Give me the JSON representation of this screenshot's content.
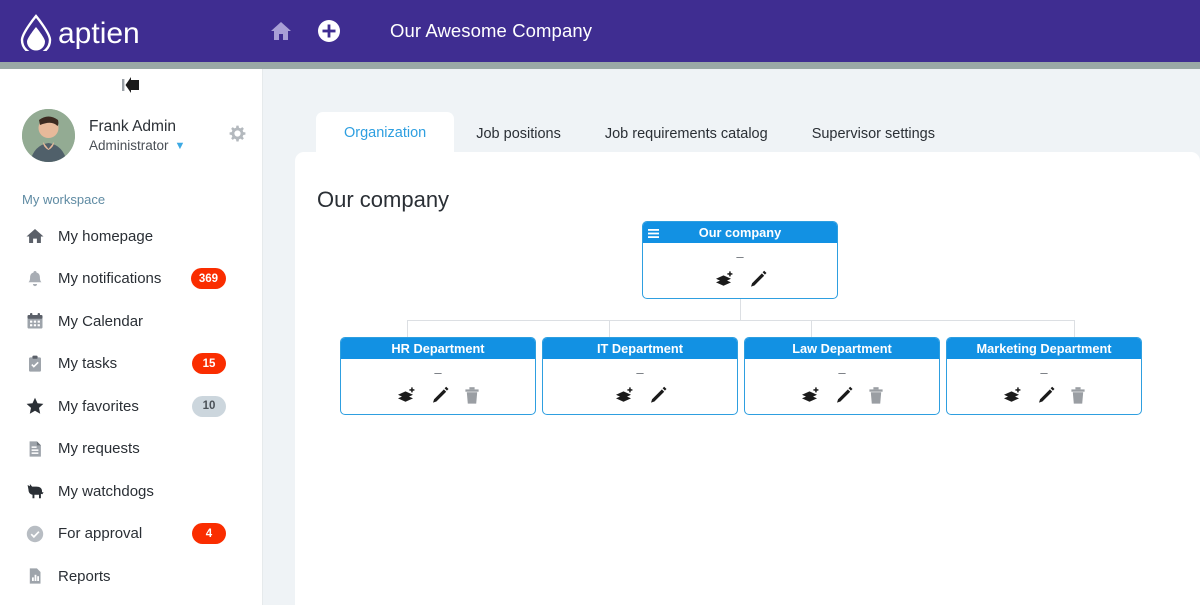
{
  "header": {
    "logo_text": "aptien",
    "logo_icon": "water-drop-logo-icon",
    "home_icon": "home-icon",
    "add_icon": "plus-circle-icon",
    "app_title": "Our Awesome Company",
    "background_color": "#3f2d91",
    "separator_color": "#9aa8a6"
  },
  "sidebar": {
    "collapse_icon": "collapse-sidebar-icon",
    "user": {
      "name": "Frank Admin",
      "role": "Administrator",
      "avatar_icon": "user-avatar",
      "caret_icon": "chevron-down-icon",
      "settings_icon": "gear-icon"
    },
    "section_label": "My workspace",
    "items": [
      {
        "label": "My homepage",
        "icon": "home-icon",
        "badge": null,
        "badge_style": null
      },
      {
        "label": "My notifications",
        "icon": "bell-icon",
        "badge": "369",
        "badge_style": "red"
      },
      {
        "label": "My Calendar",
        "icon": "calendar-icon",
        "badge": null,
        "badge_style": null
      },
      {
        "label": "My tasks",
        "icon": "clipboard-check-icon",
        "badge": "15",
        "badge_style": "red"
      },
      {
        "label": "My favorites",
        "icon": "star-icon",
        "badge": "10",
        "badge_style": "gray"
      },
      {
        "label": "My requests",
        "icon": "document-icon",
        "badge": null,
        "badge_style": null
      },
      {
        "label": "My watchdogs",
        "icon": "dog-icon",
        "badge": null,
        "badge_style": null
      },
      {
        "label": "For approval",
        "icon": "check-circle-icon",
        "badge": "4",
        "badge_style": "red"
      },
      {
        "label": "Reports",
        "icon": "bar-chart-icon",
        "badge": null,
        "badge_style": null
      }
    ],
    "badge_red_color": "#fa2d00",
    "badge_gray_color": "#ccd6dd"
  },
  "main": {
    "tabs": [
      {
        "label": "Organization",
        "active": true
      },
      {
        "label": "Job positions",
        "active": false
      },
      {
        "label": "Job requirements catalog",
        "active": false
      },
      {
        "label": "Supervisor settings",
        "active": false
      }
    ],
    "page_title": "Our company",
    "active_tab_color": "#2e9fe0"
  },
  "chart_data": {
    "type": "org-chart",
    "node_header_color": "#1291e3",
    "node_border_color": "#2e9fe0",
    "connector_color": "#dcdfe3",
    "placeholder_value": "–",
    "root": {
      "title": "Our company",
      "menu_icon": "hamburger-menu-icon",
      "value": "–",
      "actions": [
        {
          "icon": "add-layer-icon",
          "name": "add-child-node"
        },
        {
          "icon": "pencil-icon",
          "name": "edit-node"
        }
      ]
    },
    "children": [
      {
        "title": "HR Department",
        "value": "–",
        "actions": [
          {
            "icon": "add-layer-icon",
            "name": "add-child-node"
          },
          {
            "icon": "pencil-icon",
            "name": "edit-node"
          },
          {
            "icon": "trash-icon",
            "name": "delete-node"
          }
        ]
      },
      {
        "title": "IT Department",
        "value": "–",
        "actions": [
          {
            "icon": "add-layer-icon",
            "name": "add-child-node"
          },
          {
            "icon": "pencil-icon",
            "name": "edit-node"
          }
        ]
      },
      {
        "title": "Law Department",
        "value": "–",
        "actions": [
          {
            "icon": "add-layer-icon",
            "name": "add-child-node"
          },
          {
            "icon": "pencil-icon",
            "name": "edit-node"
          },
          {
            "icon": "trash-icon",
            "name": "delete-node"
          }
        ]
      },
      {
        "title": "Marketing Department",
        "value": "–",
        "actions": [
          {
            "icon": "add-layer-icon",
            "name": "add-child-node"
          },
          {
            "icon": "pencil-icon",
            "name": "edit-node"
          },
          {
            "icon": "trash-icon",
            "name": "delete-node"
          }
        ]
      }
    ]
  }
}
